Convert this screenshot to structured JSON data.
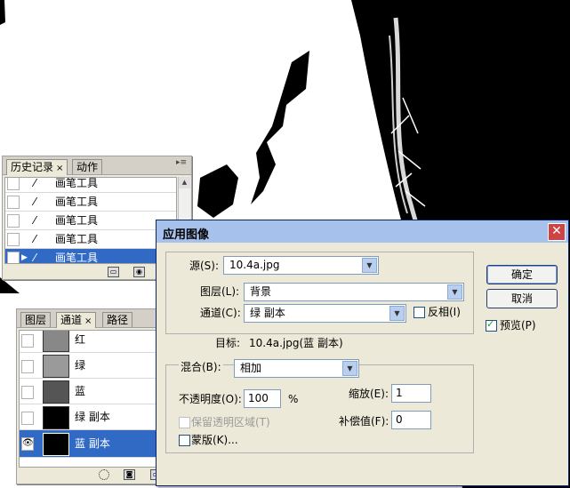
{
  "history_panel": {
    "tabs": [
      {
        "label": "历史记录"
      },
      {
        "label": "动作"
      }
    ],
    "items": [
      {
        "label": "画笔工具"
      },
      {
        "label": "画笔工具"
      },
      {
        "label": "画笔工具"
      },
      {
        "label": "画笔工具"
      },
      {
        "label": "画笔工具",
        "selected": true
      }
    ]
  },
  "channels_panel": {
    "tabs": [
      {
        "label": "图层"
      },
      {
        "label": "通道"
      },
      {
        "label": "路径"
      }
    ],
    "channels": [
      {
        "label": "红"
      },
      {
        "label": "绿"
      },
      {
        "label": "蓝"
      },
      {
        "label": "绿 副本"
      },
      {
        "label": "蓝 副本",
        "selected": true,
        "visible": true
      }
    ]
  },
  "dialog": {
    "title": "应用图像",
    "source_label": "源(S):",
    "source_value": "10.4a.jpg",
    "layer_label": "图层(L):",
    "layer_value": "背景",
    "channel_label": "通道(C):",
    "channel_value": "绿 副本",
    "invert_label": "反相(I)",
    "target_label": "目标:",
    "target_value": "10.4a.jpg(蓝 副本)",
    "blending_label": "混合(B):",
    "blending_value": "相加",
    "opacity_label": "不透明度(O):",
    "opacity_value": "100",
    "percent": "%",
    "scale_label": "缩放(E):",
    "scale_value": "1",
    "offset_label": "补偿值(F):",
    "offset_value": "0",
    "preserve_transparency_label": "保留透明区域(T)",
    "mask_label": "蒙版(K)...",
    "ok_label": "确定",
    "cancel_label": "取消",
    "preview_label": "预览(P)",
    "preview_checked": true
  }
}
